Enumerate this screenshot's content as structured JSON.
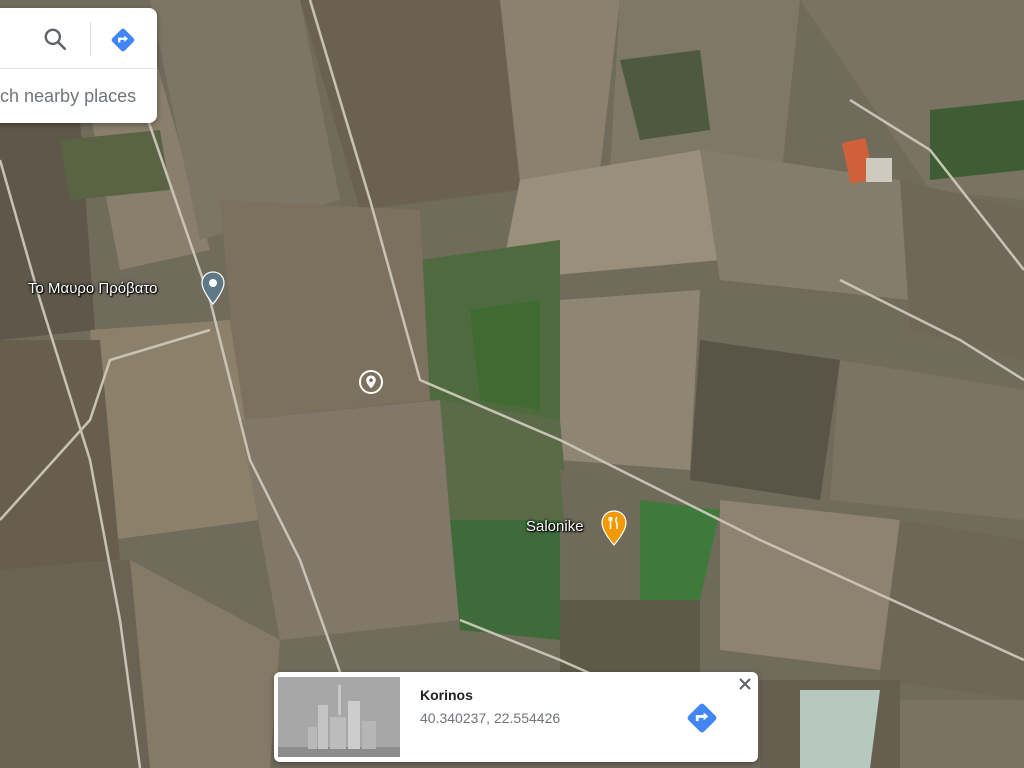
{
  "search": {
    "nearby_text": "Search nearby places",
    "icon": "search-icon",
    "directions_icon": "directions-icon"
  },
  "places": [
    {
      "label": "Το Μαυρο Πρόβατο",
      "icon": "location-pin-icon"
    },
    {
      "label": "Salonike",
      "icon": "restaurant-icon",
      "accent": "#f29900"
    }
  ],
  "selected_pin_icon": "selected-location-pin-icon",
  "info_card": {
    "title": "Korinos",
    "coordinates": "40.340237, 22.554426",
    "directions_icon": "directions-icon",
    "close_icon": "close-icon"
  },
  "colors": {
    "directions_blue": "#4285f4",
    "restaurant_orange": "#f29900",
    "pin_gray": "#5e7887"
  }
}
